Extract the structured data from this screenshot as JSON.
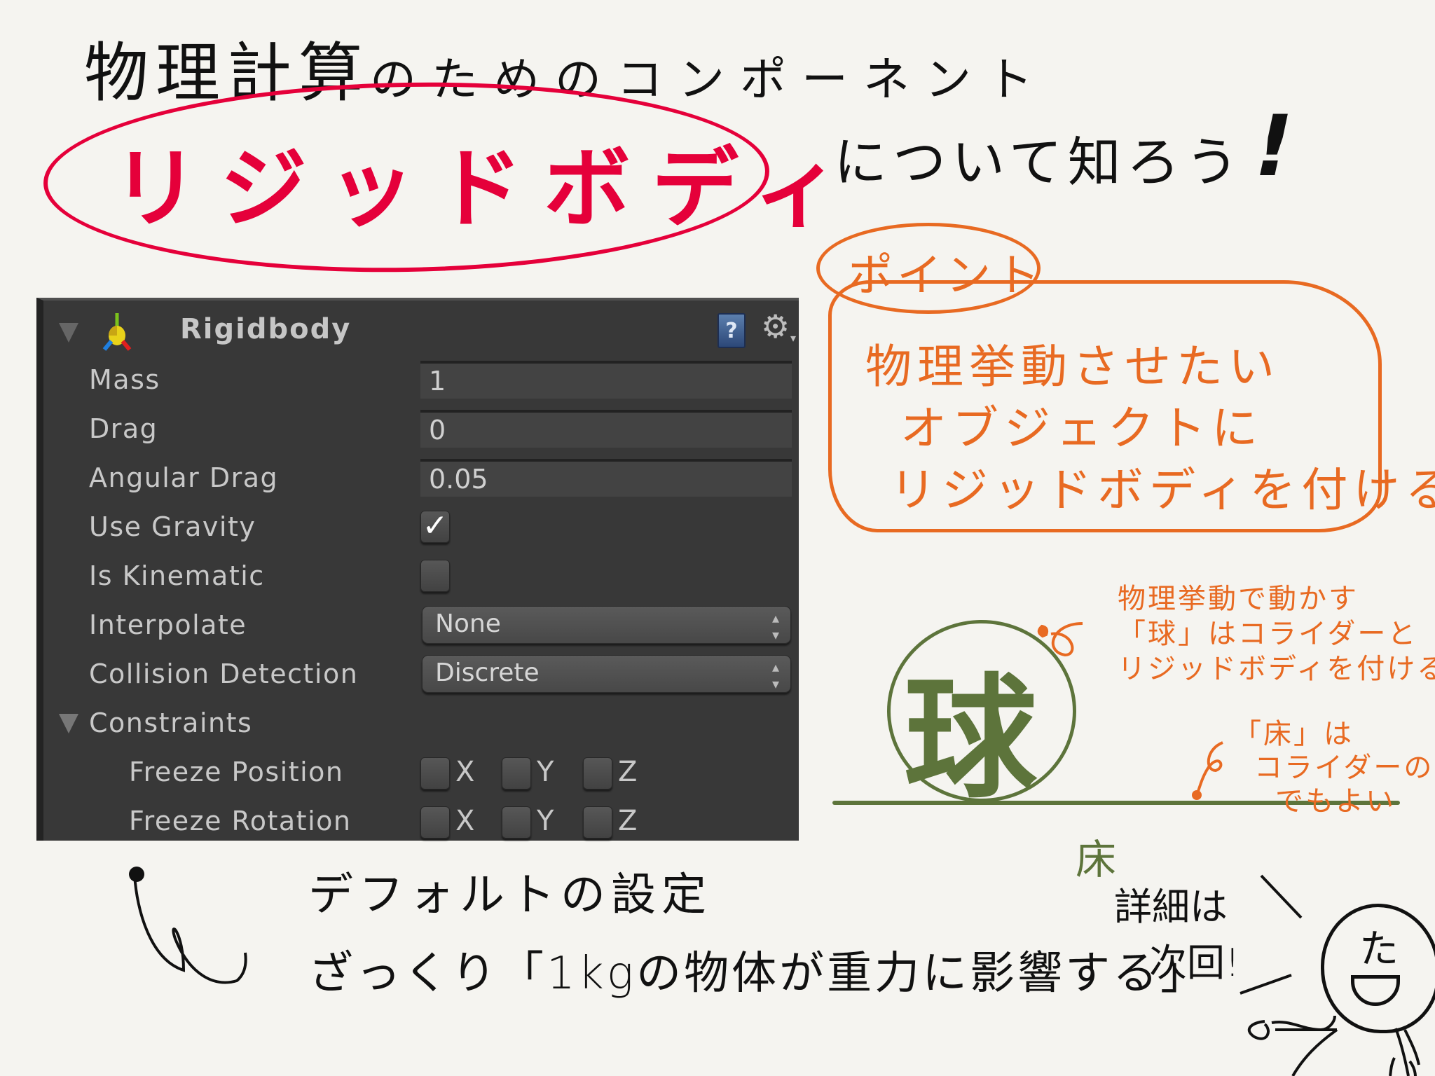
{
  "title": {
    "kanji": "物理計算",
    "rest": "のためのコンポーネント",
    "topic": "リジッドボディ",
    "suffix": "について知ろう",
    "exclaim": "!"
  },
  "inspector": {
    "component_title": "Rigidbody",
    "help_icon": "?",
    "gear_icon": "⚙",
    "gear_caret": "▾",
    "fields": {
      "mass": {
        "label": "Mass",
        "value": "1"
      },
      "drag": {
        "label": "Drag",
        "value": "0"
      },
      "angular_drag": {
        "label": "Angular Drag",
        "value": "0.05"
      },
      "use_gravity": {
        "label": "Use Gravity",
        "checked": true,
        "mark": "✓"
      },
      "is_kinematic": {
        "label": "Is Kinematic",
        "checked": false,
        "mark": ""
      },
      "interpolate": {
        "label": "Interpolate",
        "value": "None"
      },
      "collision_detection": {
        "label": "Collision Detection",
        "value": "Discrete"
      }
    },
    "select_arrows": "▴▾",
    "constraints": {
      "label": "Constraints",
      "freeze_position": {
        "label": "Freeze Position",
        "x": "X",
        "y": "Y",
        "z": "Z"
      },
      "freeze_rotation": {
        "label": "Freeze Rotation",
        "x": "X",
        "y": "Y",
        "z": "Z"
      }
    }
  },
  "point": {
    "label": "ポイント",
    "lines": [
      "物理挙動させたい",
      "オブジェクトに",
      "リジッドボディを付ける"
    ]
  },
  "diagram": {
    "ball_label": "球",
    "floor_label": "床",
    "ball_note": [
      "物理挙動で動かす",
      "「球」はコライダーと",
      "リジッドボディを付ける"
    ],
    "floor_note": [
      "「床」は",
      "コライダーのみ",
      "でもよい"
    ]
  },
  "bottom": {
    "default_label": "デフォルトの設定",
    "summary": "ざっくり「1kgの物体が重力に影響する」",
    "next_line_1": "詳細は",
    "next_line_2": "次回!",
    "character_face": "た"
  },
  "colors": {
    "accent_red": "#e5003a",
    "accent_orange": "#e86a22",
    "diagram_green": "#5d743b",
    "ink": "#111111",
    "paper": "#f5f4f0",
    "inspector_bg": "#383838"
  }
}
